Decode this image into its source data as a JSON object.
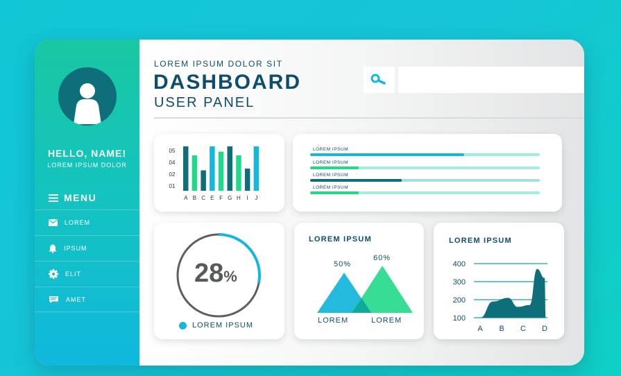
{
  "sidebar": {
    "greeting": "HELLO, NAME!",
    "subtitle": "LOREM IPSUM DOLOR",
    "menu_title": "MENU",
    "items": [
      {
        "label": "LOREM",
        "icon": "mail-icon"
      },
      {
        "label": "IPSUM",
        "icon": "bell-icon"
      },
      {
        "label": "ELIT",
        "icon": "gear-icon"
      },
      {
        "label": "AMET",
        "icon": "chat-icon"
      }
    ]
  },
  "header": {
    "subtitle": "LOREM IPSUM DOLOR SIT",
    "title": "DASHBOARD",
    "panel": "USER PANEL",
    "search_icon": "search-icon",
    "search_placeholder": ""
  },
  "colors": {
    "navy": "#0e4d6b",
    "teal_dark": "#0e6f7a",
    "teal": "#11a89a",
    "green": "#22d98a",
    "blue": "#17b6dc",
    "track": "#a4ecdb"
  },
  "progress": {
    "label": "LOREM IPSUM",
    "bars": [
      {
        "label": "LOREM IPSUM",
        "value": 0.67,
        "color": "#17b6dc",
        "track": "#a4ecdb"
      },
      {
        "label": "LOREM IPSUM",
        "value": 0.21,
        "color": "#22d98a",
        "track": "#a4ecdb"
      },
      {
        "label": "LOREM IPSUM",
        "value": 0.4,
        "color": "#0e6f7a",
        "track": "#a5dde5"
      },
      {
        "label": "LOREM IPSUM",
        "value": 0.21,
        "color": "#22d98a",
        "track": "#a4ecdb"
      }
    ]
  },
  "gauge": {
    "value_text": "28",
    "unit": "%",
    "value": 0.28,
    "legend": "LOREM IPSUM"
  },
  "triangles": {
    "title": "LOREM IPSUM",
    "items": [
      {
        "label": "LOREM",
        "percent": "50%",
        "value": 50,
        "color": "#17b6dc"
      },
      {
        "label": "LOREM",
        "percent": "60%",
        "value": 60,
        "color": "#22d98a"
      }
    ]
  },
  "area": {
    "title": "LOREM IPSUM"
  },
  "chart_data": [
    {
      "type": "bar",
      "categories": [
        "A",
        "B",
        "C",
        "E",
        "F",
        "G",
        "H",
        "I",
        "J"
      ],
      "series": [
        {
          "values": [
            5.0,
            4.0,
            2.3,
            5.0,
            4.4,
            5.0,
            4.0,
            2.5,
            5.0
          ]
        }
      ],
      "bar_colors": [
        "#0e6f7a",
        "#22d98a",
        "#0e6f7a",
        "#17b6dc",
        "#22d98a",
        "#0e6f7a",
        "#22d98a",
        "#0e6f7a",
        "#17b6dc"
      ],
      "yticks": [
        "05",
        "04",
        "02",
        "01"
      ],
      "ylim": [
        0,
        5
      ]
    },
    {
      "type": "area",
      "categories": [
        "A",
        "B",
        "C",
        "D"
      ],
      "yticks": [
        100,
        200,
        300,
        400
      ],
      "ylim": [
        100,
        400
      ],
      "points": [
        [
          0,
          100
        ],
        [
          0.6,
          190
        ],
        [
          1.3,
          210
        ],
        [
          1.75,
          160
        ],
        [
          2.3,
          170
        ],
        [
          2.65,
          370
        ],
        [
          3.0,
          320
        ],
        [
          3.05,
          100
        ]
      ],
      "fill": "#0e6f7a"
    }
  ]
}
